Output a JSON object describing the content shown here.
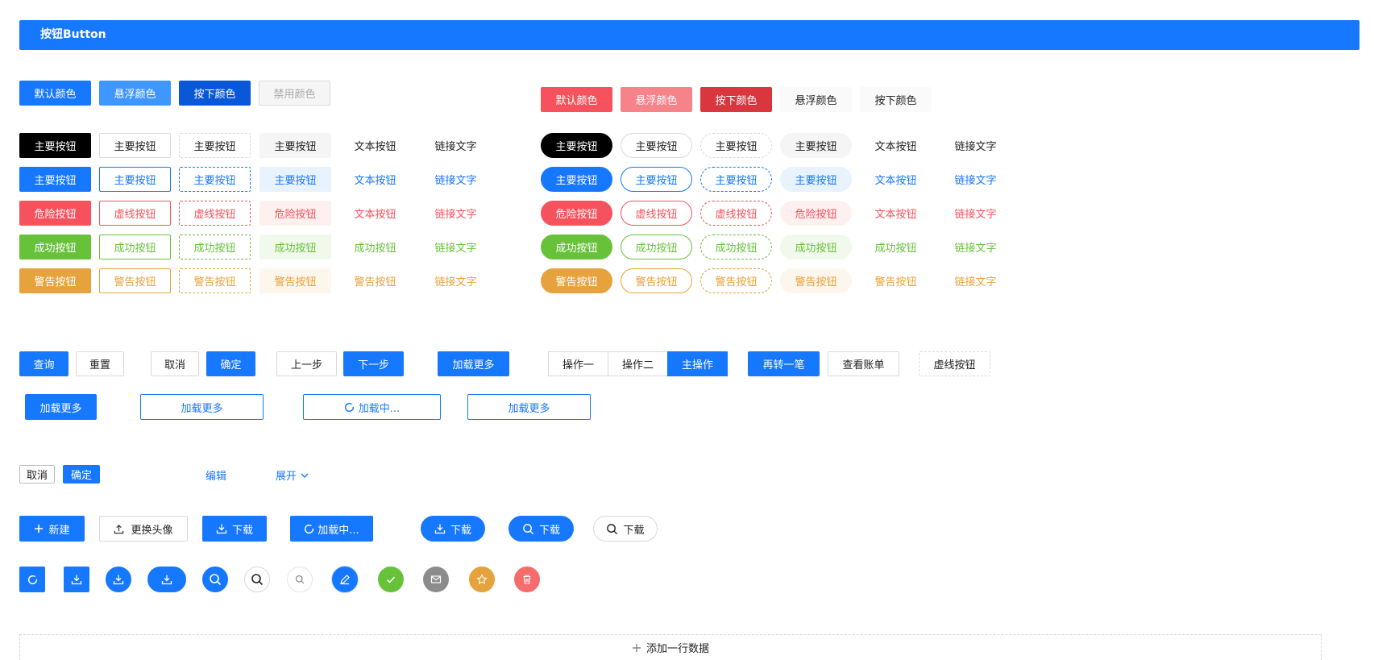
{
  "header": {
    "title": "按钮Button"
  },
  "state_row": {
    "default": "默认颜色",
    "hover": "悬浮颜色",
    "pressed": "按下颜色",
    "disabled": "禁用颜色"
  },
  "red_state_row": {
    "default": "默认颜色",
    "hover": "悬浮颜色",
    "pressed": "按下颜色",
    "light_hover": "悬浮颜色",
    "light_pressed": "按下颜色"
  },
  "variant_grid": {
    "rows": [
      {
        "color": "black",
        "labels": [
          "主要按钮",
          "主要按钮",
          "主要按钮",
          "主要按钮",
          "文本按钮",
          "链接文字"
        ]
      },
      {
        "color": "blue",
        "labels": [
          "主要按钮",
          "主要按钮",
          "主要按钮",
          "主要按钮",
          "文本按钮",
          "链接文字"
        ]
      },
      {
        "color": "red",
        "labels": [
          "危险按钮",
          "虚线按钮",
          "虚线按钮",
          "危险按钮",
          "文本按钮",
          "链接文字"
        ]
      },
      {
        "color": "green",
        "labels": [
          "成功按钮",
          "成功按钮",
          "成功按钮",
          "成功按钮",
          "成功按钮",
          "链接文字"
        ]
      },
      {
        "color": "orange",
        "labels": [
          "警告按钮",
          "警告按钮",
          "警告按钮",
          "警告按钮",
          "警告按钮",
          "链接文字"
        ]
      }
    ]
  },
  "toolbar": {
    "query": "查询",
    "reset": "重置",
    "cancel": "取消",
    "confirm": "确定",
    "prev": "上一步",
    "next": "下一步",
    "load_more": "加载更多",
    "op1": "操作一",
    "op2": "操作二",
    "main_op": "主操作",
    "again": "再转一笔",
    "view_bill": "查看账单",
    "dashed": "虚线按钮"
  },
  "load_row": {
    "load_more_1": "加载更多",
    "load_more_2": "加载更多",
    "loading": "加载中...",
    "load_more_3": "加载更多"
  },
  "small_row": {
    "cancel": "取消",
    "confirm": "确定",
    "edit": "编辑",
    "expand": "展开"
  },
  "icon_row": {
    "new": "新建",
    "change_avatar": "更换头像",
    "download": "下载",
    "loading": "加载中...",
    "download_round": "下载",
    "search_round": "下载",
    "search_white": "下载"
  },
  "add_row": {
    "label": "添加一行数据"
  },
  "colors": {
    "primary": "#1677ff",
    "danger": "#f5525d",
    "success": "#67c23a",
    "warning": "#e6a23c"
  }
}
